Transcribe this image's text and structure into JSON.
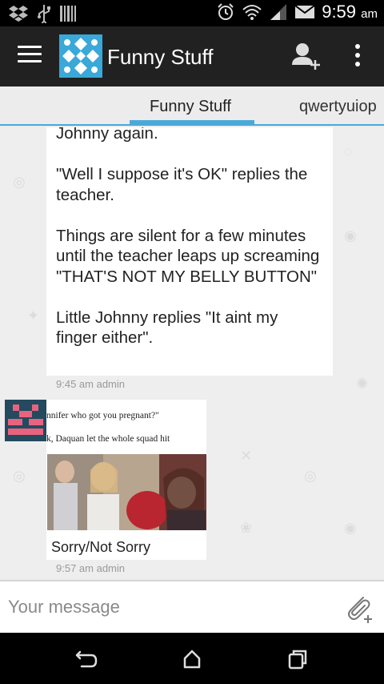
{
  "status_bar": {
    "time": "9:59",
    "ampm": "am",
    "icons": [
      "dropbox-icon",
      "usb-icon",
      "barcode-icon",
      "alarm-icon",
      "wifi-icon",
      "signal-icon",
      "mail-icon"
    ]
  },
  "app_bar": {
    "title": "Funny Stuff",
    "icons": [
      "menu-icon",
      "app-logo",
      "add-user-icon",
      "more-vert-icon"
    ]
  },
  "tabs": [
    {
      "label": "Funny Stuff",
      "active": true
    },
    {
      "label": "qwertyuiop",
      "active": false
    }
  ],
  "accent_color": "#4aa9d9",
  "messages": [
    {
      "text": "Johnny again.\n\n\"Well I suppose it's OK\" replies the teacher.\n\nThings are silent for a few minutes until the teacher leaps up screaming \"THAT'S NOT MY BELLY BUTTON\"\n\nLittle Johnny replies \"It aint my finger either\".",
      "meta": "9:45 am admin"
    },
    {
      "meme_line_1": "nnifer who got you pregnant?\"",
      "meme_line_2": "k, Daquan let the whole squad hit",
      "caption": "Sorry/Not Sorry",
      "meta": "9:57 am admin"
    }
  ],
  "composer": {
    "placeholder": "Your message",
    "value": ""
  },
  "nav_bar": {
    "icons": [
      "back-icon",
      "home-icon",
      "recent-apps-icon"
    ]
  }
}
